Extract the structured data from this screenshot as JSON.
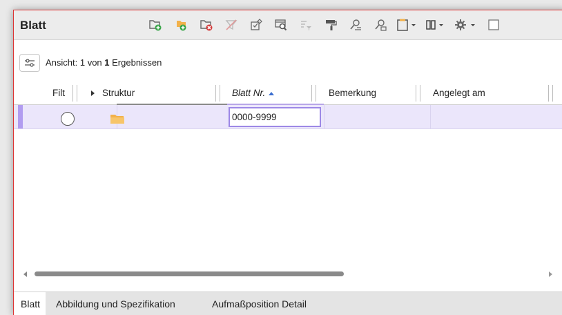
{
  "window": {
    "title": "Blatt"
  },
  "toolbar": {
    "icons": [
      "new-folder-icon",
      "add-folder-icon",
      "delete-folder-icon",
      "filter-off-icon",
      "edit-checklist-icon",
      "preview-search-icon",
      "sort-filter-icon",
      "format-painter-icon",
      "search-user-icon",
      "search-list-icon",
      "clipboard-dropdown-icon",
      "columns-dropdown-icon",
      "settings-dropdown-icon",
      "checkbox-icon"
    ]
  },
  "view": {
    "prefix": "Ansicht: 1 von ",
    "count": "1",
    "suffix": " Ergebnissen"
  },
  "table": {
    "columns": [
      "Filt",
      "Struktur",
      "Blatt Nr.",
      "Bemerkung",
      "Angelegt am"
    ],
    "rows": [
      {
        "blatt_nr": "0000-9999",
        "bemerkung": "",
        "angelegt_am": ""
      }
    ]
  },
  "tabs": [
    "Blatt",
    "Abbildung und Spezifikation",
    "Aufmaßposition Detail"
  ],
  "colors": {
    "selection": "#ebe6fb",
    "accent": "#9d88e6",
    "folder": "#f2b14a",
    "green": "#3aa64a",
    "red": "#d33b3b"
  }
}
